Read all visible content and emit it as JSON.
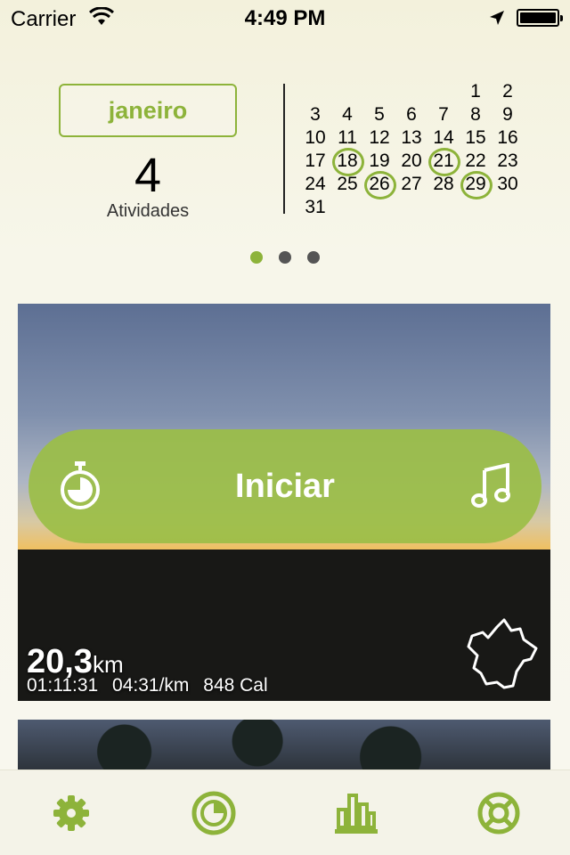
{
  "status_bar": {
    "carrier": "Carrier",
    "time": "4:49 PM"
  },
  "summary": {
    "month": "janeiro",
    "activity_count": "4",
    "activity_label": "Atividades"
  },
  "calendar": {
    "weeks": [
      [
        "",
        "",
        "",
        "",
        "",
        "1",
        "2"
      ],
      [
        "3",
        "4",
        "5",
        "6",
        "7",
        "8",
        "9"
      ],
      [
        "10",
        "11",
        "12",
        "13",
        "14",
        "15",
        "16"
      ],
      [
        "17",
        "18",
        "19",
        "20",
        "21",
        "22",
        "23"
      ],
      [
        "24",
        "25",
        "26",
        "27",
        "28",
        "29",
        "30"
      ],
      [
        "31",
        "",
        "",
        "",
        "",
        "",
        ""
      ]
    ],
    "marked_days": [
      "18",
      "21",
      "26",
      "29"
    ]
  },
  "pager": {
    "count": 3,
    "active": 0
  },
  "start_button": {
    "label": "Iniciar"
  },
  "activity": {
    "distance": "20,3",
    "distance_unit": "km",
    "duration": "01:11:31",
    "pace": "04:31/km",
    "calories": "848 Cal"
  },
  "tabs": [
    {
      "name": "settings",
      "icon": "gear-icon"
    },
    {
      "name": "activity",
      "icon": "timer-icon"
    },
    {
      "name": "stats",
      "icon": "bar-chart-icon"
    },
    {
      "name": "help",
      "icon": "lifebuoy-icon"
    }
  ],
  "colors": {
    "accent": "#8db33a"
  }
}
